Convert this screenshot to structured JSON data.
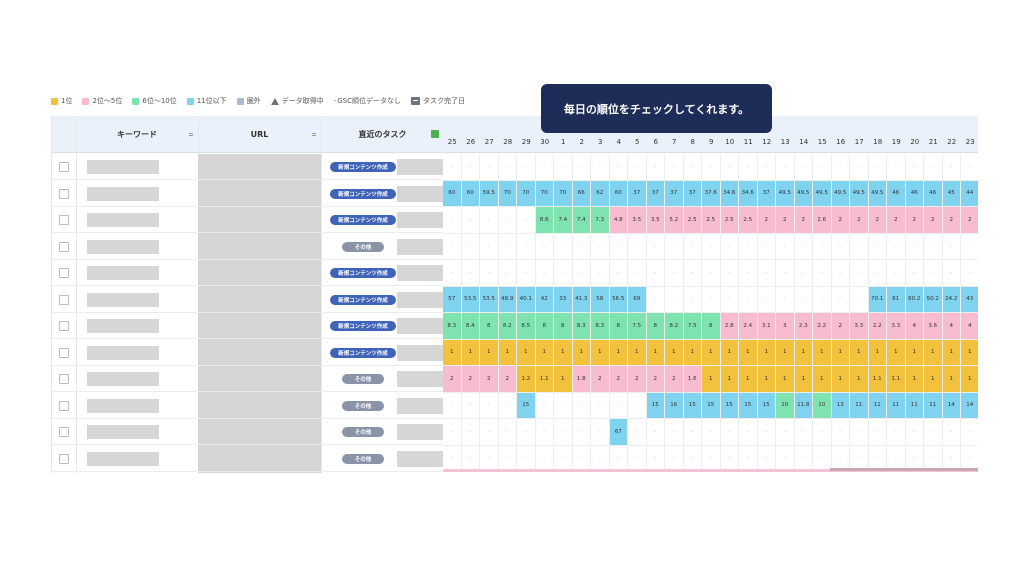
{
  "legend": [
    {
      "label": "1位",
      "color": "#f2c23c",
      "kind": "swatch"
    },
    {
      "label": "2位〜5位",
      "color": "#f8bcd0",
      "kind": "swatch"
    },
    {
      "label": "6位〜10位",
      "color": "#7fe3b0",
      "kind": "swatch"
    },
    {
      "label": "11位以下",
      "color": "#7fd3ef",
      "kind": "swatch"
    },
    {
      "label": "圏外",
      "color": "#a9b9d6",
      "kind": "swatch"
    },
    {
      "label": "データ取得中",
      "color": "#6b7280",
      "kind": "triangle"
    },
    {
      "label": "GSC順位データなし",
      "color": "#6b7280",
      "kind": "dash"
    },
    {
      "label": "タスク完了日",
      "color": "#6b7280",
      "kind": "flag"
    }
  ],
  "tooltip": "毎日の順位をチェックしてくれます。",
  "headers": {
    "keyword": "キーワード",
    "url": "URL",
    "task": "直近のタスク"
  },
  "days": [
    "25",
    "26",
    "27",
    "28",
    "29",
    "30",
    "1",
    "2",
    "3",
    "4",
    "5",
    "6",
    "7",
    "8",
    "9",
    "10",
    "11",
    "12",
    "13",
    "14",
    "15",
    "16",
    "17",
    "18",
    "19",
    "20",
    "21",
    "22",
    "23"
  ],
  "rows": [
    {
      "task": "新規コンテンツ作成",
      "type": "new",
      "values": [
        "-",
        "-",
        "-",
        "-",
        "-",
        "-",
        "-",
        "-",
        "-",
        "-",
        "-",
        "-",
        "-",
        "-",
        "-",
        "-",
        "-",
        "-",
        "-",
        "-",
        "-",
        "-",
        "-",
        "-",
        "-",
        "-",
        "-",
        "-",
        "-"
      ]
    },
    {
      "task": "新規コンテンツ作成",
      "type": "new",
      "values": [
        "60",
        "60",
        "59.5",
        "70",
        "70",
        "70",
        "70",
        "66",
        "62",
        "60",
        "37",
        "37",
        "37",
        "37",
        "37.6",
        "34.6",
        "34.6",
        "37",
        "49.5",
        "49.5",
        "49.5",
        "49.5",
        "49.5",
        "49.5",
        "46",
        "46",
        "46",
        "45",
        "44"
      ]
    },
    {
      "task": "新規コンテンツ作成",
      "type": "new",
      "values": [
        "-",
        "-",
        "-",
        "-",
        "-",
        "8.6",
        "7.4",
        "7.4",
        "7.3",
        "4.8",
        "3.5",
        "3.5",
        "5.2",
        "2.5",
        "2.5",
        "2.5",
        "2.5",
        "2",
        "2",
        "2",
        "2.6",
        "2",
        "2",
        "2",
        "2",
        "2",
        "2",
        "2",
        "2"
      ]
    },
    {
      "task": "その他",
      "type": "other",
      "values": [
        "-",
        "-",
        "-",
        "-",
        "-",
        "-",
        "-",
        "-",
        "-",
        "-",
        "-",
        "-",
        "-",
        "-",
        "-",
        "-",
        "-",
        "-",
        "-",
        "-",
        "-",
        "-",
        "-",
        "-",
        "-",
        "-",
        "-",
        "-",
        "-"
      ]
    },
    {
      "task": "新規コンテンツ作成",
      "type": "new",
      "values": [
        "-",
        "-",
        "-",
        "-",
        "-",
        "-",
        "-",
        "-",
        "-",
        "-",
        "-",
        "-",
        "-",
        "-",
        "-",
        "-",
        "-",
        "-",
        "-",
        "-",
        "-",
        "-",
        "-",
        "-",
        "-",
        "-",
        "-",
        "-",
        "-"
      ]
    },
    {
      "task": "新規コンテンツ作成",
      "type": "new",
      "values": [
        "57",
        "53.5",
        "53.5",
        "48.9",
        "40.1",
        "42",
        "33",
        "41.3",
        "58",
        "56.5",
        "69",
        "-",
        "-",
        "-",
        "-",
        "-",
        "-",
        "-",
        "-",
        "-",
        "-",
        "-",
        "-",
        "70.1",
        "61",
        "60.2",
        "50.2",
        "24.2",
        "43"
      ]
    },
    {
      "task": "新規コンテンツ作成",
      "type": "new",
      "values": [
        "8.3",
        "8.4",
        "8",
        "8.2",
        "8.5",
        "8",
        "8",
        "8.3",
        "8.3",
        "8",
        "7.5",
        "8",
        "8.2",
        "7.5",
        "8",
        "2.8",
        "2.4",
        "3.1",
        "3",
        "2.3",
        "2.2",
        "2",
        "3.3",
        "2.2",
        "3.3",
        "4",
        "3.6",
        "4",
        "4"
      ]
    },
    {
      "task": "新規コンテンツ作成",
      "type": "new",
      "values": [
        "1",
        "1",
        "1",
        "1",
        "1",
        "1",
        "1",
        "1",
        "1",
        "1",
        "1",
        "1",
        "1",
        "1",
        "1",
        "1",
        "1",
        "1",
        "1",
        "1",
        "1",
        "1",
        "1",
        "1",
        "1",
        "1",
        "1",
        "1",
        "1"
      ]
    },
    {
      "task": "その他",
      "type": "other",
      "values": [
        "2",
        "2",
        "2",
        "2",
        "1.2",
        "1.1",
        "1",
        "1.8",
        "2",
        "2",
        "2",
        "2",
        "2",
        "1.6",
        "1",
        "1",
        "1",
        "1",
        "1",
        "1",
        "1",
        "1",
        "1",
        "1.1",
        "1.1",
        "1",
        "1",
        "1",
        "1"
      ]
    },
    {
      "task": "その他",
      "type": "other",
      "values": [
        "-",
        "-",
        "-",
        "-",
        "15",
        "-",
        "-",
        "-",
        "-",
        "-",
        "-",
        "15",
        "16",
        "15",
        "15",
        "15",
        "15",
        "15",
        "10",
        "11.8",
        "10",
        "13",
        "11",
        "11",
        "11",
        "11",
        "11",
        "14",
        "14"
      ]
    },
    {
      "task": "その他",
      "type": "other",
      "values": [
        "-",
        "-",
        "-",
        "-",
        "-",
        "-",
        "-",
        "-",
        "-",
        "67",
        "-",
        "-",
        "-",
        "-",
        "-",
        "-",
        "-",
        "-",
        "-",
        "-",
        "-",
        "-",
        "-",
        "-",
        "-",
        "-",
        "-",
        "-",
        "-"
      ]
    },
    {
      "task": "その他",
      "type": "other",
      "values": [
        "-",
        "-",
        "-",
        "-",
        "-",
        "-",
        "-",
        "-",
        "-",
        "-",
        "-",
        "-",
        "-",
        "-",
        "-",
        "-",
        "-",
        "-",
        "-",
        "-",
        "-",
        "-",
        "-",
        "-",
        "-",
        "-",
        "-",
        "-",
        "-"
      ]
    }
  ],
  "colors": {
    "rank1": "#f2c23c",
    "rank2to5": "#f8bcd0",
    "rank6to10": "#7fe3b0",
    "rank11plus": "#7fd3ef",
    "none": "#ffffff",
    "tooltip_bg": "#1d2d57"
  }
}
